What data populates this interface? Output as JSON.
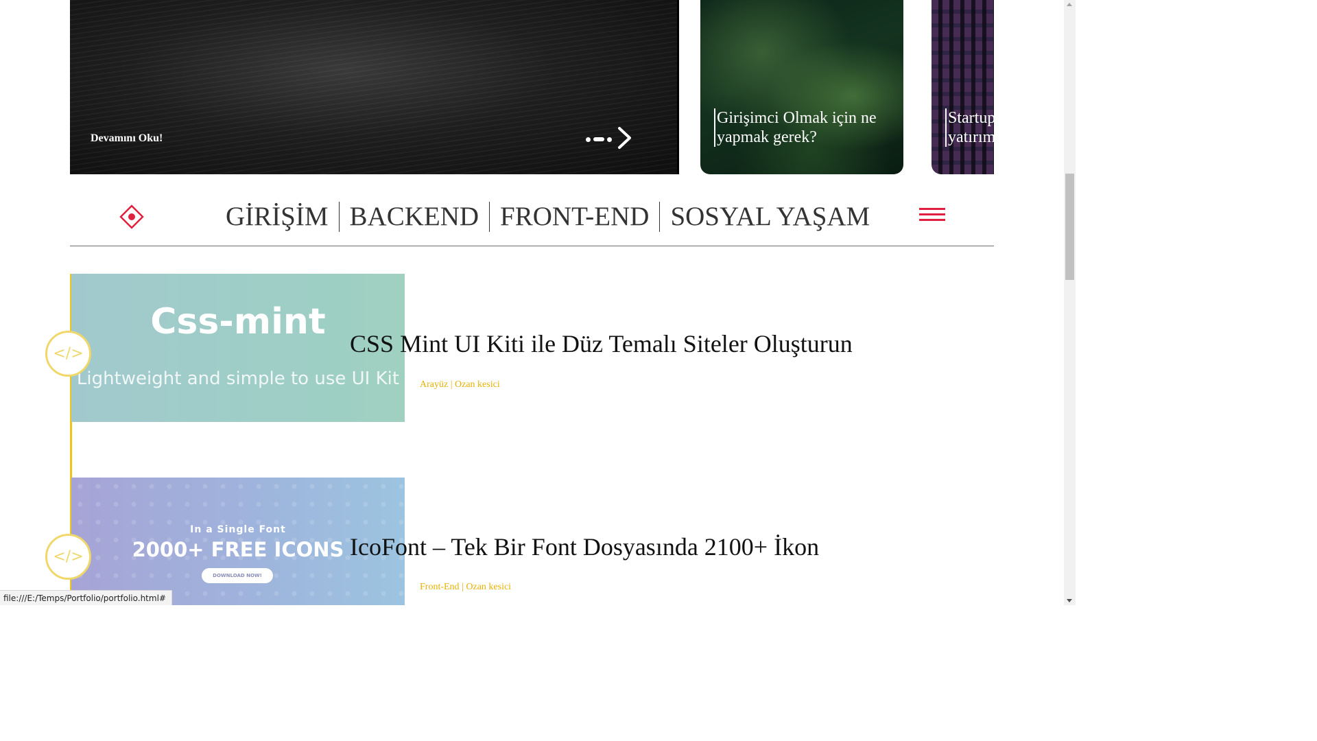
{
  "slider": {
    "read_more": "Devamını Oku!",
    "cards": [
      {
        "title_line1": "Girişimci Olmak için ne",
        "title_line2": "yapmak gerek?"
      },
      {
        "title_line1": "Startup",
        "title_line2": "yatırım"
      }
    ],
    "active_dot": 2,
    "dot_count": 3
  },
  "nav": {
    "items": [
      "GİRİŞİM",
      "BACKEND",
      "FRONT-END",
      "SOSYAL YAŞAM"
    ],
    "logo_icon": "diamond-logo-icon",
    "menu_icon": "hamburger-icon"
  },
  "posts": [
    {
      "thumb_title": "Css-mint",
      "thumb_subtitle": "Lightweight and simple to use UI Kit",
      "badge": "</>",
      "title": "CSS Mint UI Kiti ile Düz Temalı Siteler Oluşturun",
      "category": "Arayüz",
      "separator": " | ",
      "author": "Ozan kesici"
    },
    {
      "thumb_kicker": "In a Single Font",
      "thumb_title": "2000+ FREE ICONS",
      "thumb_button": "DOWNLOAD NOW!",
      "badge": "</>",
      "title": "IcoFont – Tek Bir Font Dosyasında 2100+ İkon",
      "category": "Front-End",
      "separator": " | ",
      "author": "Ozan kesici"
    }
  ],
  "status": {
    "url": "file:///E:/Temps/Portfolio/portfolio.html#"
  },
  "colors": {
    "accent_red": "#e0203e",
    "accent_yellow": "#f0c419",
    "meta_yellow": "#e8b100"
  }
}
